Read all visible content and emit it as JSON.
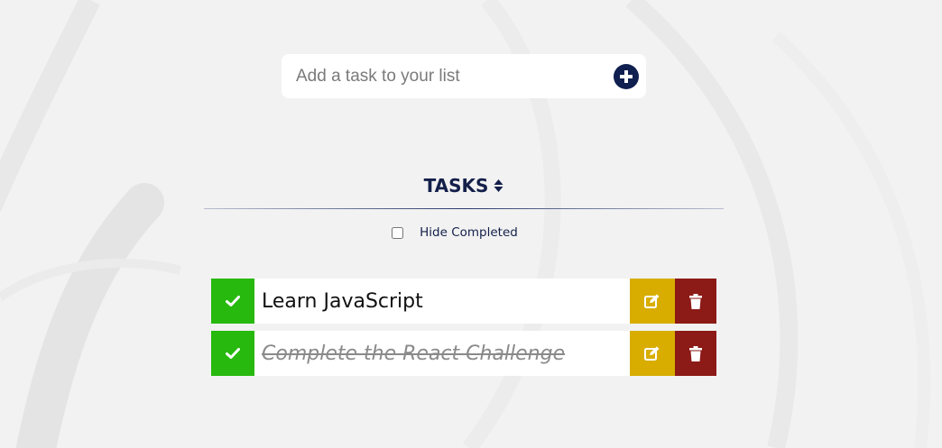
{
  "add_task": {
    "placeholder": "Add a task to your list",
    "add_icon": "plus-circle-icon"
  },
  "tasks_header": {
    "title": "TASKS",
    "sort_icon": "sort-icon"
  },
  "filter": {
    "hide_completed_label": "Hide Completed",
    "hide_completed_checked": false
  },
  "tasks": [
    {
      "text": "Learn JavaScript",
      "completed": false
    },
    {
      "text": "Complete the React Challenge",
      "completed": true
    }
  ],
  "colors": {
    "complete_button": "#27b90e",
    "edit_button": "#d8ad00",
    "delete_button": "#8c1a17",
    "header_text": "#14204a",
    "add_button": "#0f1f4f"
  },
  "icons": {
    "check": "check-icon",
    "edit": "edit-icon",
    "delete": "trash-icon"
  }
}
